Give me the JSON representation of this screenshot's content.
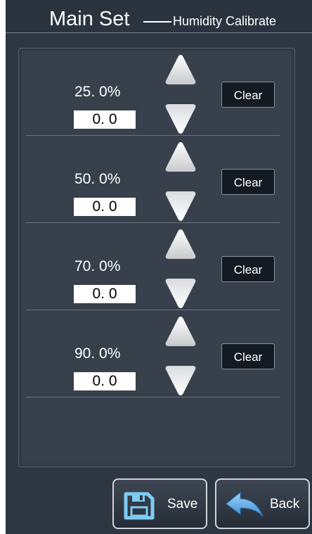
{
  "header": {
    "title": "Main Set",
    "subtitle": "Humidity Calibrate"
  },
  "rows": [
    {
      "percent": "25. 0%",
      "value": "0. 0",
      "clear_label": "Clear"
    },
    {
      "percent": "50. 0%",
      "value": "0. 0",
      "clear_label": "Clear"
    },
    {
      "percent": "70. 0%",
      "value": "0. 0",
      "clear_label": "Clear"
    },
    {
      "percent": "90. 0%",
      "value": "0. 0",
      "clear_label": "Clear"
    }
  ],
  "footer": {
    "save_label": "Save",
    "back_label": "Back"
  },
  "icons": {
    "increase": "up-triangle-icon",
    "decrease": "down-triangle-icon",
    "save": "floppy-disk-icon",
    "back": "back-arrow-icon"
  },
  "colors": {
    "background": "#2e3642",
    "panel": "#37404b",
    "clear_button": "#141a22",
    "save_icon": "#7ecbf2",
    "back_icon": "#5aa9e6"
  }
}
